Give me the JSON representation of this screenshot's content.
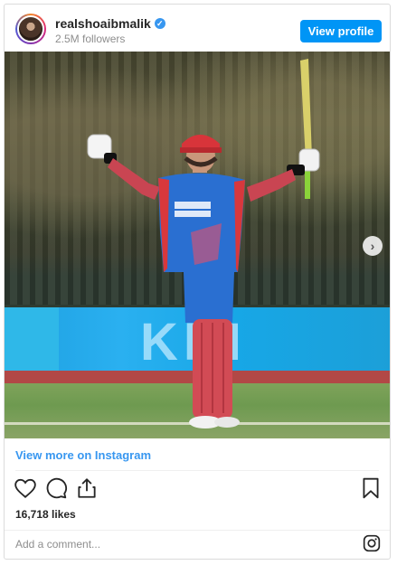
{
  "header": {
    "username": "realshoaibmalik",
    "verified_mark": "✓",
    "followers": "2.5M followers",
    "view_profile_label": "View profile"
  },
  "photo": {
    "board_text": "KRI",
    "icons": {
      "next": "chevron-right-icon"
    }
  },
  "post": {
    "view_more_label": "View more on Instagram",
    "likes": "16,718 likes",
    "comment_placeholder": "Add a comment..."
  },
  "icons": {
    "like": "heart-icon",
    "comment": "comment-icon",
    "share": "share-icon",
    "save": "bookmark-icon",
    "instagram": "instagram-icon"
  },
  "colors": {
    "accent": "#0095f6",
    "link": "#3897f0",
    "kit_blue": "#2a6fd1",
    "kit_red": "#d8383c"
  }
}
